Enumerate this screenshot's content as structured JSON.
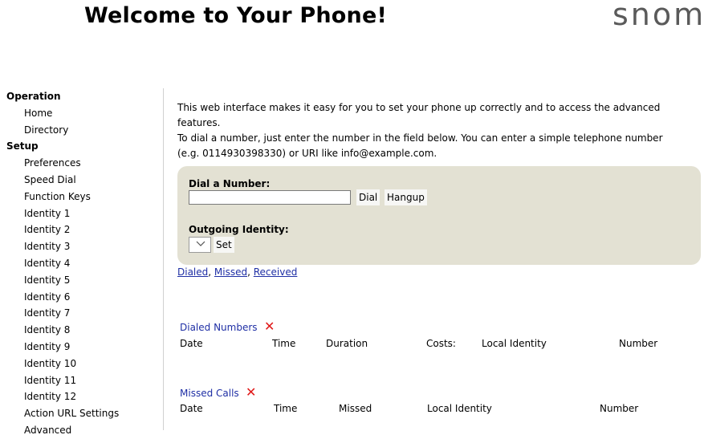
{
  "header": {
    "title": "Welcome to Your Phone!",
    "logo": "snom"
  },
  "sidebar": {
    "sections": [
      {
        "label": "Operation",
        "items": [
          "Home",
          "Directory"
        ]
      },
      {
        "label": "Setup",
        "items": [
          "Preferences",
          "Speed Dial",
          "Function Keys",
          "Identity 1",
          "Identity 2",
          "Identity 3",
          "Identity 4",
          "Identity 5",
          "Identity 6",
          "Identity 7",
          "Identity 8",
          "Identity 9",
          "Identity 10",
          "Identity 11",
          "Identity 12",
          "Action URL Settings",
          "Advanced"
        ]
      }
    ]
  },
  "intro": {
    "line1": "This web interface makes it easy for you to set your phone up correctly and to access the advanced",
    "line2": "features.",
    "line3": "To dial a number, just enter the number in the field below. You can enter a simple telephone number",
    "line4": "(e.g. 0114930398330) or URI like info@example.com."
  },
  "dial": {
    "label": "Dial a Number:",
    "value": "",
    "dial_button": "Dial",
    "hangup_button": "Hangup",
    "identity_label": "Outgoing Identity:",
    "identity_selected": "",
    "set_button": "Set",
    "dropdown_icon": "chevron-down-icon"
  },
  "links": {
    "dialed": "Dialed",
    "missed": "Missed",
    "received": "Received",
    "sep": ", "
  },
  "dialed_numbers": {
    "title": "Dialed Numbers",
    "delete_icon": "delete-x-icon",
    "columns": [
      "Date",
      "Time",
      "Duration",
      "Costs:",
      "Local Identity",
      "Number"
    ]
  },
  "missed_calls": {
    "title": "Missed Calls",
    "delete_icon": "delete-x-icon",
    "columns": [
      "Date",
      "Time",
      "Missed",
      "Local Identity",
      "Number"
    ]
  },
  "colors": {
    "link": "#1f2fa5",
    "delete": "#e01818",
    "panel": "#e3e1d3"
  }
}
